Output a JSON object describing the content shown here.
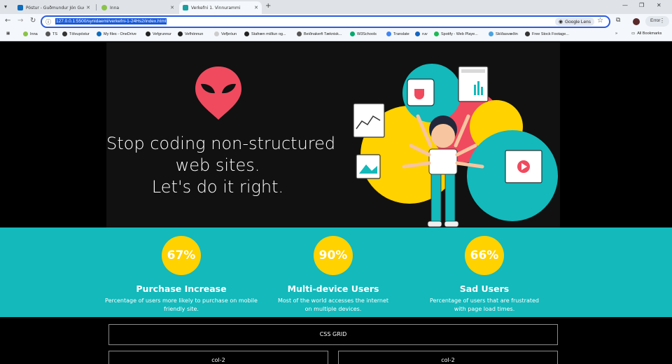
{
  "browser": {
    "tabs": [
      {
        "title": "Póstur - Guðmundur Jón Guðjó",
        "favicon_color": "#0f6cbd",
        "active": false
      },
      {
        "title": "Inna",
        "favicon_color": "#8bc34a",
        "active": false
      },
      {
        "title": "Verkefni 1. Vinnurammi",
        "favicon_color": "#18a0a0",
        "active": true
      }
    ],
    "new_tab_glyph": "+",
    "url": "127.0.0.1:5500/synidaemi/verkefni-1-24Hs2/index.html",
    "lens_label": "Google Lens",
    "error_label": "Error",
    "bookmarks": [
      {
        "label": "Inna",
        "color": "#8bc34a"
      },
      {
        "label": "TS",
        "color": "#555555"
      },
      {
        "label": "Tölvupóstur",
        "color": "#333333"
      },
      {
        "label": "My files - OneDrive",
        "color": "#0f6cbd"
      },
      {
        "label": "Vefgrunnur",
        "color": "#222222"
      },
      {
        "label": "Vefhönnun",
        "color": "#222222"
      },
      {
        "label": "Vefþróun",
        "color": "#cccccc"
      },
      {
        "label": "Stafræn miðlun og...",
        "color": "#222222"
      },
      {
        "label": "Beiðnakerfi Tæknisk...",
        "color": "#555555"
      },
      {
        "label": "W3Schools",
        "color": "#04aa6d"
      },
      {
        "label": "Translate",
        "color": "#4285f4"
      },
      {
        "label": "ruv",
        "color": "#1565c0"
      },
      {
        "label": "Spotify - Web Playe...",
        "color": "#1db954"
      },
      {
        "label": "Skíðasvæðin",
        "color": "#4aa3df"
      },
      {
        "label": "Free Stock Footage...",
        "color": "#333333"
      }
    ],
    "all_bookmarks_label": "All Bookmarks"
  },
  "page": {
    "hero": {
      "line1": "Stop coding non-structured",
      "line2": "web sites.",
      "line3": "Let's do it right.",
      "logo_color": "#f04a5f"
    },
    "stats": [
      {
        "value": "67%",
        "title": "Purchase Increase",
        "desc": "Percentage of users more likely to purchase on mobile friendly site."
      },
      {
        "value": "90%",
        "title": "Multi-device Users",
        "desc": "Most of the world accesses the internet on multiple devices."
      },
      {
        "value": "66%",
        "title": "Sad Users",
        "desc": "Percentage of users that are frustrated with page load times."
      }
    ],
    "grid": {
      "full": "CSS GRID",
      "col_a": "col-2",
      "col_b": "col-2"
    },
    "colors": {
      "teal": "#13b9bb",
      "yellow": "#ffd200",
      "hero_bg": "#111111"
    }
  }
}
